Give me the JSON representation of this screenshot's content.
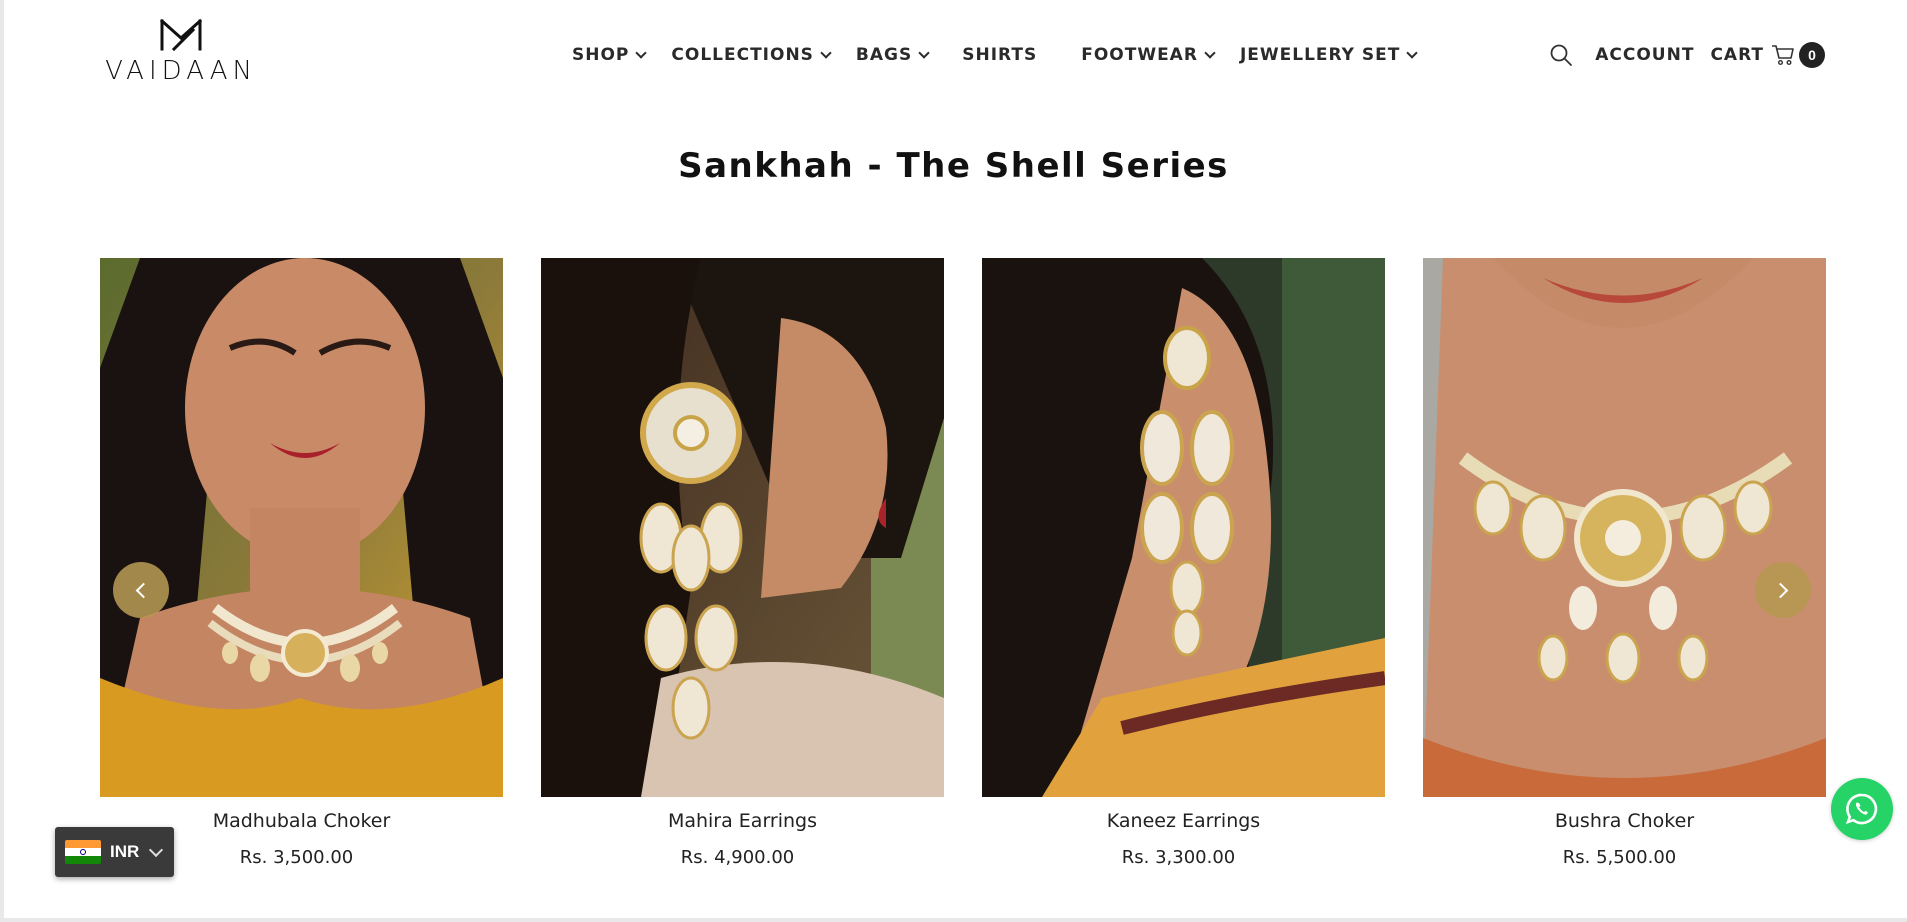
{
  "brand": {
    "logo_text": "VAIDAAN"
  },
  "nav": {
    "items": [
      {
        "label": "SHOP",
        "has_dropdown": true
      },
      {
        "label": "COLLECTIONS",
        "has_dropdown": true
      },
      {
        "label": "BAGS",
        "has_dropdown": true
      },
      {
        "label": "SHIRTS",
        "has_dropdown": false
      },
      {
        "label": "FOOTWEAR",
        "has_dropdown": true
      },
      {
        "label": "JEWELLERY SET",
        "has_dropdown": true
      }
    ]
  },
  "header": {
    "search_icon": "search-icon",
    "account_label": "ACCOUNT",
    "cart_label": "CART",
    "cart_icon": "cart-icon",
    "cart_count": "0"
  },
  "section": {
    "title": "Sankhah - The Shell Series"
  },
  "products": [
    {
      "name": "Madhubala Choker",
      "price": "Rs. 3,500.00"
    },
    {
      "name": "Mahira Earrings",
      "price": "Rs. 4,900.00"
    },
    {
      "name": "Kaneez Earrings",
      "price": "Rs. 3,300.00"
    },
    {
      "name": "Bushra Choker",
      "price": "Rs. 5,500.00"
    }
  ],
  "carousel": {
    "prev_icon": "chevron-left-icon",
    "next_icon": "chevron-right-icon"
  },
  "currency": {
    "code": "INR",
    "flag_icon": "india-flag-icon"
  },
  "whatsapp": {
    "icon": "whatsapp-icon"
  },
  "colors": {
    "accent": "#b59852",
    "whatsapp": "#25d366",
    "text": "#222222",
    "currency_bg": "#3a3a3a"
  }
}
